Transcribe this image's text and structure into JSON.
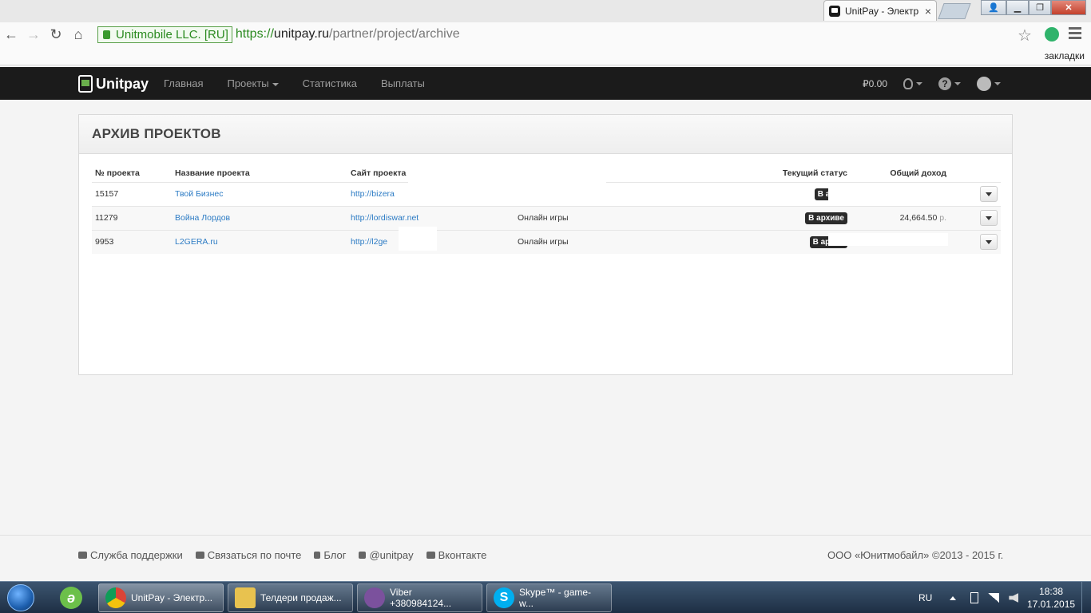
{
  "browser": {
    "tab_title": "UnitPay - Электр",
    "ev_label": "Unitmobile LLC. [RU]",
    "url_scheme": "https://",
    "url_host": "unitpay.ru",
    "url_path": "/partner/project/archive",
    "bookmarks_other": "закладки"
  },
  "navbar": {
    "brand": "Unitpay",
    "links": [
      "Главная",
      "Проекты",
      "Статистика",
      "Выплаты"
    ],
    "balance": "₽0.00"
  },
  "panel": {
    "title": "АРХИВ ПРОЕКТОВ",
    "columns": [
      "№ проекта",
      "Название проекта",
      "Сайт проекта",
      "",
      "Текущий статус",
      "Общий доход"
    ],
    "rows": [
      {
        "id": "15157",
        "name": "Твой Бизнес",
        "site": "http://bizera",
        "category": "",
        "status": "В архи",
        "income": "",
        "currency": ""
      },
      {
        "id": "11279",
        "name": "Война Лордов",
        "site": "http://lordiswar.net",
        "category": "Онлайн игры",
        "status": "В архиве",
        "income": "24,664.50",
        "currency": "р."
      },
      {
        "id": "9953",
        "name": "L2GERA.ru",
        "site": "http://l2ge",
        "category": "Онлайн игры",
        "status": "В архив",
        "income": "",
        "currency": ""
      }
    ]
  },
  "footer": {
    "links": [
      "Служба поддержки",
      "Связаться по почте",
      "Блог",
      "@unitpay",
      "Вконтакте"
    ],
    "copyright": "ООО «Юнитмобайл» ©2013 - 2015 г."
  },
  "taskbar": {
    "items": [
      "UnitPay - Электр...",
      "Телдери продаж...",
      "Viber +380984124...",
      "Skype™ - game-w..."
    ],
    "lang": "RU",
    "time": "18:38",
    "date": "17.01.2015"
  }
}
